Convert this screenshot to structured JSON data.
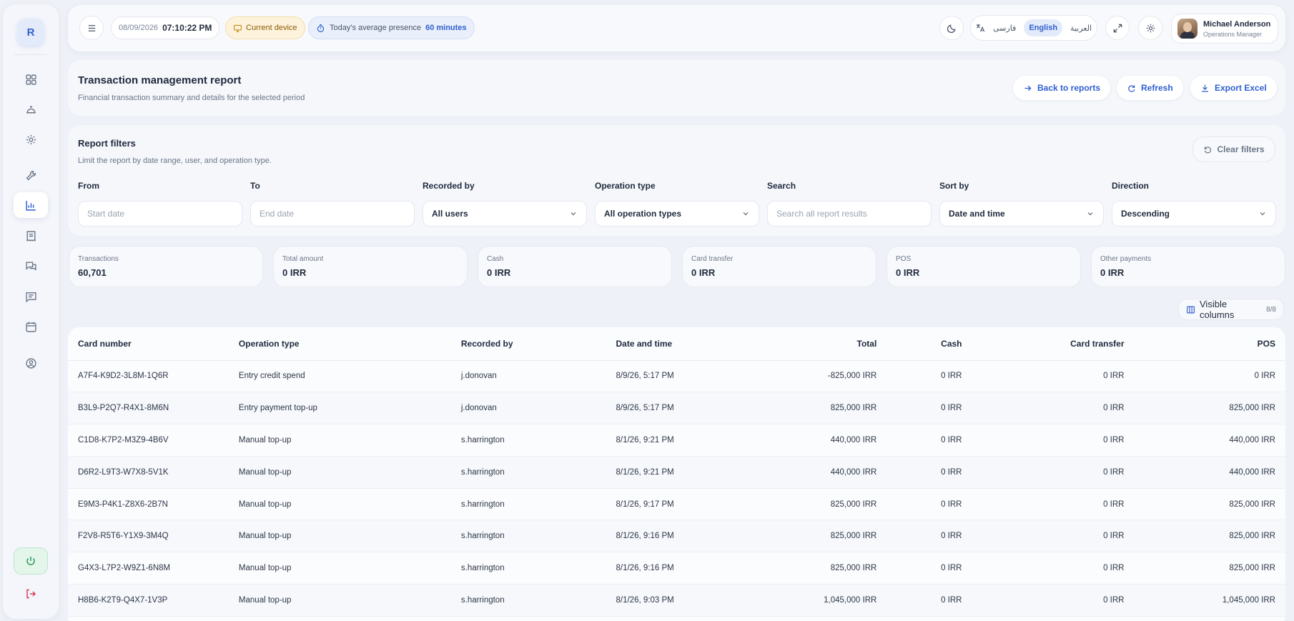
{
  "sidebar": {
    "logo_letter": "R",
    "items": [
      {
        "icon": "dashboard-icon",
        "active": false
      },
      {
        "icon": "service-bell-icon",
        "active": false
      },
      {
        "icon": "gear-icon",
        "active": false
      },
      {
        "icon": "wrench-icon",
        "active": false
      },
      {
        "icon": "bar-chart-icon",
        "active": true
      },
      {
        "icon": "receipt-icon",
        "active": false
      },
      {
        "icon": "chat-icon",
        "active": false
      },
      {
        "icon": "message-list-icon",
        "active": false
      },
      {
        "icon": "calendar-icon",
        "active": false
      },
      {
        "icon": "user-circle-icon",
        "active": false
      }
    ],
    "power_icon": "power-icon",
    "logout_icon": "logout-icon"
  },
  "topbar": {
    "date": "08/09/2026",
    "time": "07:10:22 PM",
    "device_label": "Current device",
    "presence_label": "Today's average presence",
    "presence_value": "60 minutes",
    "languages": [
      "فارسی",
      "English",
      "العربية"
    ],
    "active_language": "English",
    "user_name": "Michael Anderson",
    "user_role": "Operations Manager"
  },
  "header": {
    "title": "Transaction management report",
    "subtitle": "Financial transaction summary and details for the selected period",
    "back_label": "Back to reports",
    "refresh_label": "Refresh",
    "export_label": "Export Excel"
  },
  "filters": {
    "title": "Report filters",
    "subtitle": "Limit the report by date range, user, and operation type.",
    "clear_label": "Clear filters",
    "from_label": "From",
    "from_placeholder": "Start date",
    "to_label": "To",
    "to_placeholder": "End date",
    "recorded_label": "Recorded by",
    "recorded_value": "All users",
    "optype_label": "Operation type",
    "optype_value": "All operation types",
    "search_label": "Search",
    "search_placeholder": "Search all report results",
    "sort_label": "Sort by",
    "sort_value": "Date and time",
    "direction_label": "Direction",
    "direction_value": "Descending"
  },
  "stats": [
    {
      "label": "Transactions",
      "value": "60,701"
    },
    {
      "label": "Total amount",
      "value": "0 IRR"
    },
    {
      "label": "Cash",
      "value": "0 IRR"
    },
    {
      "label": "Card transfer",
      "value": "0 IRR"
    },
    {
      "label": "POS",
      "value": "0 IRR"
    },
    {
      "label": "Other payments",
      "value": "0 IRR"
    }
  ],
  "visible_columns": {
    "label": "Visible columns",
    "count": "8/8"
  },
  "table": {
    "headers": [
      "Card number",
      "Operation type",
      "Recorded by",
      "Date and time",
      "Total",
      "Cash",
      "Card transfer",
      "POS"
    ],
    "rows": [
      [
        "A7F4-K9D2-3L8M-1Q6R",
        "Entry credit spend",
        "j.donovan",
        "8/9/26, 5:17 PM",
        "-825,000 IRR",
        "0 IRR",
        "0 IRR",
        "0 IRR"
      ],
      [
        "B3L9-P2Q7-R4X1-8M6N",
        "Entry payment top-up",
        "j.donovan",
        "8/9/26, 5:17 PM",
        "825,000 IRR",
        "0 IRR",
        "0 IRR",
        "825,000 IRR"
      ],
      [
        "C1D8-K7P2-M3Z9-4B6V",
        "Manual top-up",
        "s.harrington",
        "8/1/26, 9:21 PM",
        "440,000 IRR",
        "0 IRR",
        "0 IRR",
        "440,000 IRR"
      ],
      [
        "D6R2-L9T3-W7X8-5V1K",
        "Manual top-up",
        "s.harrington",
        "8/1/26, 9:21 PM",
        "440,000 IRR",
        "0 IRR",
        "0 IRR",
        "440,000 IRR"
      ],
      [
        "E9M3-P4K1-Z8X6-2B7N",
        "Manual top-up",
        "s.harrington",
        "8/1/26, 9:17 PM",
        "825,000 IRR",
        "0 IRR",
        "0 IRR",
        "825,000 IRR"
      ],
      [
        "F2V8-R5T6-Y1X9-3M4Q",
        "Manual top-up",
        "s.harrington",
        "8/1/26, 9:16 PM",
        "825,000 IRR",
        "0 IRR",
        "0 IRR",
        "825,000 IRR"
      ],
      [
        "G4X3-L7P2-W9Z1-6N8M",
        "Manual top-up",
        "s.harrington",
        "8/1/26, 9:16 PM",
        "825,000 IRR",
        "0 IRR",
        "0 IRR",
        "825,000 IRR"
      ],
      [
        "H8B6-K2T9-Q4X7-1V3P",
        "Manual top-up",
        "s.harrington",
        "8/1/26, 9:03 PM",
        "1,045,000 IRR",
        "0 IRR",
        "0 IRR",
        "1,045,000 IRR"
      ]
    ]
  },
  "colors": {
    "accent": "#2f5fcf",
    "background": "#eef1f7",
    "danger": "#d9405a",
    "success": "#2e9a5a"
  }
}
